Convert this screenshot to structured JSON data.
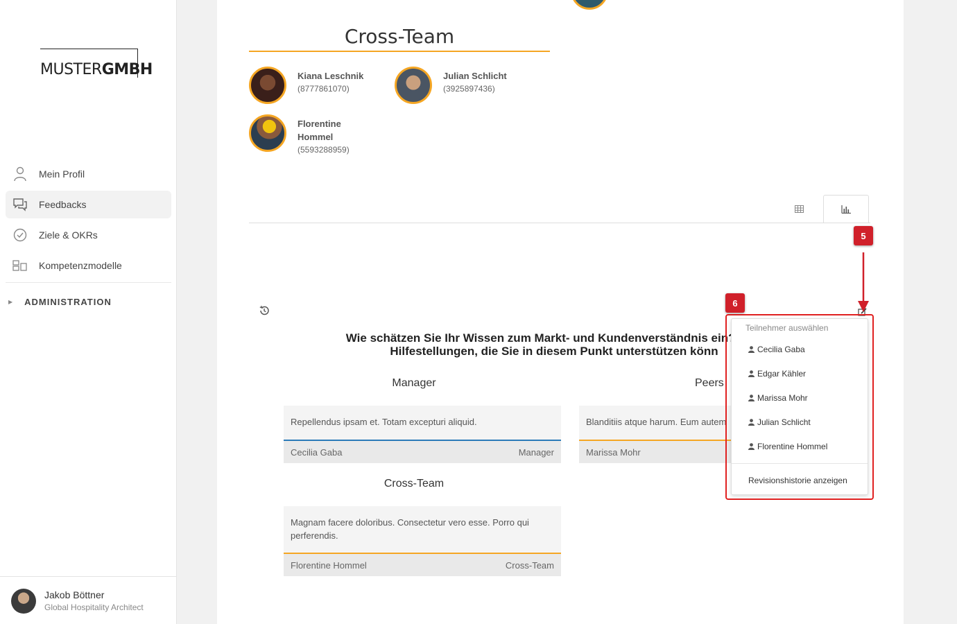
{
  "brand": {
    "logo_thin": "MUSTER",
    "logo_bold": "GMBH"
  },
  "sidebar": {
    "items": [
      {
        "label": "Mein Profil",
        "icon": "person-icon"
      },
      {
        "label": "Feedbacks",
        "icon": "chat-icon",
        "active": true
      },
      {
        "label": "Ziele & OKRs",
        "icon": "check-circle-icon"
      },
      {
        "label": "Kompetenzmodelle",
        "icon": "grid-icon"
      }
    ],
    "admin_label": "ADMINISTRATION"
  },
  "user": {
    "name": "Jakob Böttner",
    "role": "Global Hospitality Architect"
  },
  "group": {
    "title": "Cross-Team",
    "members": [
      {
        "name": "Kiana Leschnik",
        "phone": "(8777861070)"
      },
      {
        "name": "Julian Schlicht",
        "phone": "(3925897436)"
      },
      {
        "name_line1": "Florentine",
        "name_line2": "Hommel",
        "phone": "(5593288959)"
      }
    ]
  },
  "question": {
    "line1": "Wie schätzen Sie Ihr Wissen zum Markt- und Kundenverständnis ein? Gibt",
    "line2": "Hilfestellungen, die Sie in diesem Punkt unterstützen könn"
  },
  "sections": {
    "manager": {
      "title": "Manager",
      "text": "Repellendus ipsam et. Totam excepturi aliquid.",
      "author": "Cecilia Gaba",
      "role": "Manager"
    },
    "peers": {
      "title": "Peers",
      "text": "Blanditiis atque harum. Eum autem",
      "author": "Marissa Mohr"
    },
    "cross": {
      "title": "Cross-Team",
      "text": "Magnam facere doloribus. Consectetur vero esse. Porro qui perferendis.",
      "author": "Florentine Hommel",
      "role": "Cross-Team"
    }
  },
  "dropdown": {
    "header": "Teilnehmer auswählen",
    "participants": [
      "Cecilia Gaba",
      "Edgar Kähler",
      "Marissa Mohr",
      "Julian Schlicht",
      "Florentine Hommel"
    ],
    "revision": "Revisionshistorie anzeigen"
  },
  "annotations": {
    "badge_a": "5",
    "badge_b": "6"
  },
  "colors": {
    "accent": "#f5a623",
    "manager_bar": "#2b7bb9",
    "annotation": "#d0202a"
  }
}
